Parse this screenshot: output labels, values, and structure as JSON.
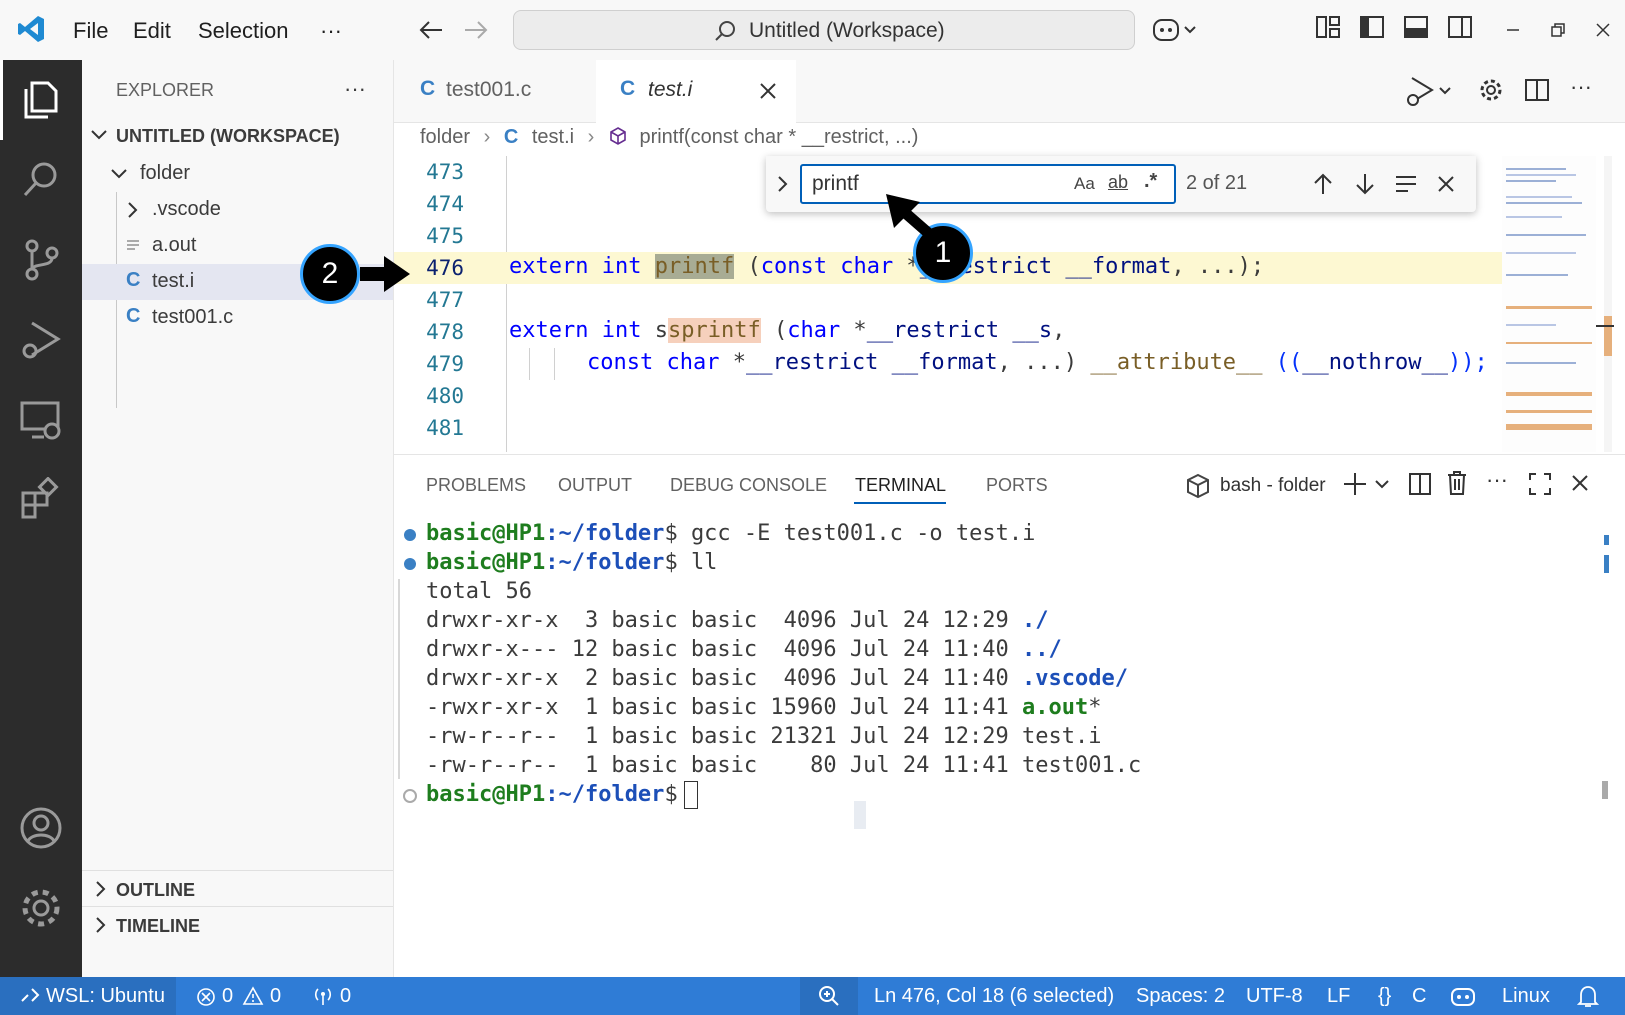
{
  "titlebar": {
    "menu": [
      "File",
      "Edit",
      "Selection",
      "···"
    ],
    "command_center": "Untitled (Workspace)"
  },
  "sidebar": {
    "title": "EXPLORER",
    "more": "···",
    "workspace": "UNTITLED (WORKSPACE)",
    "tree": [
      {
        "label": "folder",
        "kind": "folder"
      },
      {
        "label": ".vscode",
        "kind": "folder"
      },
      {
        "label": "a.out",
        "kind": "file"
      },
      {
        "label": "test.i",
        "kind": "c",
        "selected": true
      },
      {
        "label": "test001.c",
        "kind": "c"
      }
    ],
    "outline": "OUTLINE",
    "timeline": "TIMELINE"
  },
  "tabs": [
    {
      "label": "test001.c",
      "icon": "C",
      "active": false
    },
    {
      "label": "test.i",
      "icon": "C",
      "active": true
    }
  ],
  "breadcrumb": {
    "folder": "folder",
    "file": "test.i",
    "symbol": "printf(const char * __restrict, ...)"
  },
  "code": {
    "line_numbers": [
      "473",
      "474",
      "475",
      "476",
      "477",
      "478",
      "479",
      "480",
      "481"
    ],
    "line476": {
      "k1": "extern",
      "k2": "int",
      "fn": "printf",
      "k3": "const",
      "k4": "char",
      "p1": "__restrict",
      "p2": "__format",
      "rest": ", ...);"
    },
    "line478": {
      "k1": "extern",
      "k2": "int",
      "fn": "sprintf",
      "k3": "char",
      "p1": "__restrict",
      "p2": "__s",
      "rest": ","
    },
    "line479": {
      "k1": "const",
      "k2": "char",
      "p1": "__restrict",
      "p2": "__format",
      "rest": ", ...) ",
      "attr": "__attribute__",
      "nothrow": "__nothrow__",
      "end": "));"
    }
  },
  "find": {
    "query": "printf",
    "match_case": "Aa",
    "whole_word": "ab",
    "regex": ".*",
    "count": "2 of 21"
  },
  "panel": {
    "tabs": [
      "PROBLEMS",
      "OUTPUT",
      "DEBUG CONSOLE",
      "TERMINAL",
      "PORTS"
    ],
    "active_tab": "TERMINAL",
    "shell": "bash - folder"
  },
  "terminal": {
    "prompt_user": "basic@HP1",
    "prompt_path": ":~/folder",
    "lines": [
      {
        "cmd": "gcc -E test001.c -o test.i"
      },
      {
        "cmd": "ll"
      }
    ],
    "total": "total 56",
    "listing": [
      {
        "meta": "drwxr-xr-x  3 basic basic  4096 Jul 24 12:29 ",
        "name": "./",
        "color": "#1c4fb8"
      },
      {
        "meta": "drwxr-x--- 12 basic basic  4096 Jul 24 11:40 ",
        "name": "../",
        "color": "#1c4fb8"
      },
      {
        "meta": "drwxr-xr-x  2 basic basic  4096 Jul 24 11:40 ",
        "name": ".vscode/",
        "color": "#1c4fb8",
        "suffix": ""
      },
      {
        "meta": "-rwxr-xr-x  1 basic basic 15960 Jul 24 11:41 ",
        "name": "a.out",
        "color": "#1e7d1e",
        "suffix": "*"
      },
      {
        "meta": "-rw-r--r--  1 basic basic 21321 Jul 24 12:29 ",
        "name": "test.i",
        "color": "#3b3b3b"
      },
      {
        "meta": "-rw-r--r--  1 basic basic    80 Jul 24 11:41 ",
        "name": "test001.c",
        "color": "#3b3b3b"
      }
    ]
  },
  "status": {
    "remote": "WSL: Ubuntu",
    "errors": "0",
    "warnings": "0",
    "ports": "0",
    "position": "Ln 476, Col 18 (6 selected)",
    "spaces": "Spaces: 2",
    "encoding": "UTF-8",
    "eol": "LF",
    "language": "C",
    "os": "Linux"
  },
  "annotations": [
    "1",
    "2"
  ],
  "colors": {
    "accent": "#005fb8",
    "statusbar": "#2f7cd6",
    "activitybar": "#2c2c2c",
    "badge_ring": "#35a4ff"
  }
}
